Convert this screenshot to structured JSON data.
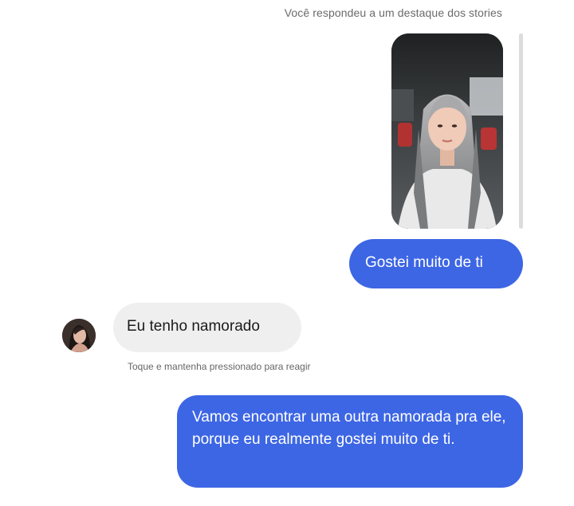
{
  "story_reply_caption": "Você respondeu a um destaque dos stories",
  "messages": [
    {
      "direction": "sent",
      "text": "Gostei muito de ti"
    },
    {
      "direction": "received",
      "text": "Eu tenho namorado"
    },
    {
      "direction": "sent",
      "text": "Vamos encontrar uma outra namorada pra ele, porque eu realmente gostei muito de ti."
    }
  ],
  "reaction_hint": "Toque e mantenha pressionado para reagir",
  "colors": {
    "sent_bubble": "#3d66e4",
    "received_bubble": "#efefef",
    "background": "#ffffff",
    "meta_text": "#6a6a6a"
  }
}
